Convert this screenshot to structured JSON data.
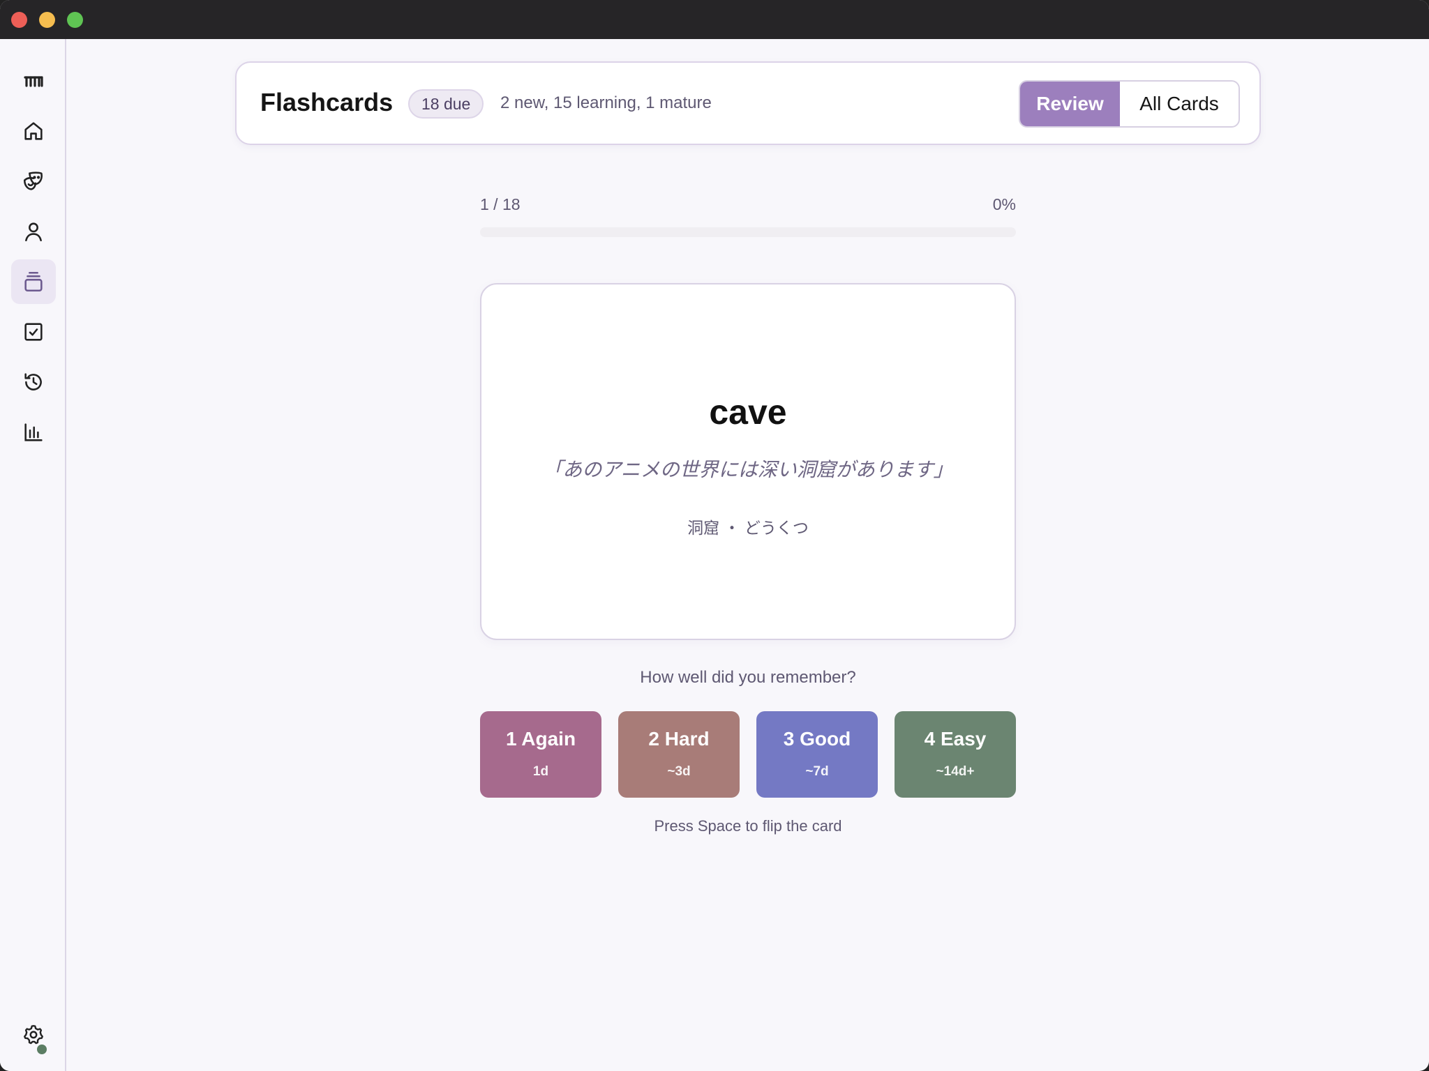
{
  "header": {
    "title": "Flashcards",
    "due_badge": "18 due",
    "counts": "2 new, 15 learning, 1 mature",
    "tabs": [
      {
        "label": "Review",
        "active": true
      },
      {
        "label": "All Cards",
        "active": false
      }
    ]
  },
  "sidebar": {
    "items": [
      {
        "icon": "logo-icon"
      },
      {
        "icon": "home-icon"
      },
      {
        "icon": "masks-icon"
      },
      {
        "icon": "person-icon"
      },
      {
        "icon": "stacked-cards-icon",
        "active": true
      },
      {
        "icon": "checkbox-icon"
      },
      {
        "icon": "history-icon"
      },
      {
        "icon": "bar-chart-icon"
      },
      {
        "icon": "gear-icon"
      }
    ]
  },
  "progress": {
    "position": "1 / 18",
    "percent_label": "0%",
    "fraction": 0
  },
  "card": {
    "word": "cave",
    "sentence": "「あのアニメの世界には深い洞窟があります」",
    "reading": "洞窟 ・ どうくつ"
  },
  "rating": {
    "prompt": "How well did you remember?",
    "buttons": [
      {
        "label": "1 Again",
        "interval": "1d",
        "color": "#a66a8d"
      },
      {
        "label": "2 Hard",
        "interval": "~3d",
        "color": "#a87c78"
      },
      {
        "label": "3 Good",
        "interval": "~7d",
        "color": "#7479c4"
      },
      {
        "label": "4 Easy",
        "interval": "~14d+",
        "color": "#6b8571"
      }
    ]
  },
  "hint": "Press Space to flip the card",
  "colors": {
    "accent": "#9c7fbd",
    "status_dot": "#5b7d63"
  }
}
